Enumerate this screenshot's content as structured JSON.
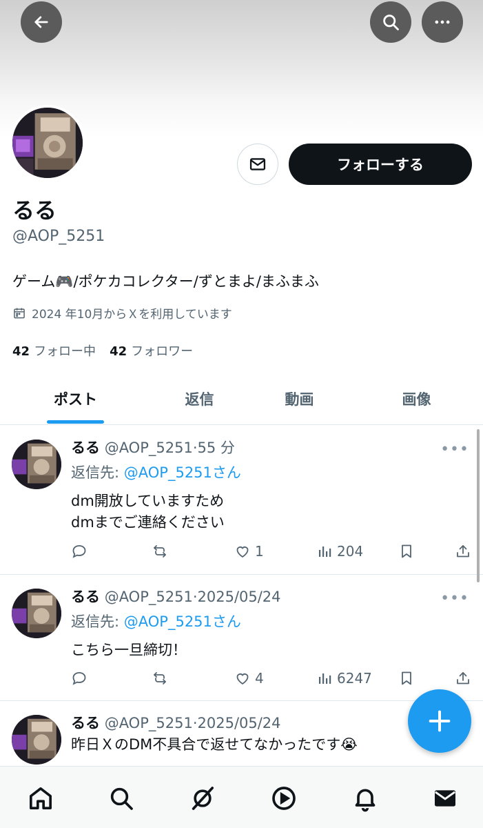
{
  "profile": {
    "display_name": "るる",
    "handle": "@AOP_5251",
    "bio": "ゲーム🎮/ポケカコレクター/ずとまよ/まふまふ",
    "joined": "2024 年10月からＸを利用しています",
    "following_count": "42",
    "following_label": "フォロー中",
    "followers_count": "42",
    "followers_label": "フォロワー",
    "follow_button": "フォローする"
  },
  "tabs": [
    {
      "label": "ポスト",
      "active": true
    },
    {
      "label": "返信",
      "active": false
    },
    {
      "label": "動画",
      "active": false
    },
    {
      "label": "画像",
      "active": false
    }
  ],
  "posts": [
    {
      "name": "るる",
      "meta": "@AOP_5251·55 分",
      "reply_prefix": "返信先: ",
      "reply_target": "@AOP_5251さん",
      "text_lines": [
        "dm開放していますため",
        "dmまでご連絡ください"
      ],
      "likes": "1",
      "views": "204"
    },
    {
      "name": "るる",
      "meta": "@AOP_5251·2025/05/24",
      "reply_prefix": "返信先: ",
      "reply_target": "@AOP_5251さん",
      "text_lines": [
        "こちら一旦締切！"
      ],
      "likes": "4",
      "views": "6247"
    },
    {
      "name": "るる",
      "meta": "@AOP_5251·2025/05/24",
      "text_lines": [
        "昨日ＸのDM不具合で返せてなかったです😭"
      ]
    }
  ],
  "icons": {
    "back": "arrow-left-icon",
    "search": "search-icon",
    "more": "more-horizontal-icon",
    "mail": "mail-icon",
    "calendar": "calendar-icon",
    "reply": "reply-icon",
    "repost": "repost-icon",
    "like": "heart-icon",
    "views": "bar-chart-icon",
    "bookmark": "bookmark-icon",
    "share": "share-icon",
    "compose": "plus-icon",
    "nav": [
      "home-icon",
      "search-icon",
      "grok-icon",
      "video-icon",
      "bell-icon",
      "mail-icon"
    ]
  },
  "colors": {
    "accent": "#1d9bf0",
    "text_primary": "#0f1419",
    "text_secondary": "#536471",
    "follow_button_bg": "#0f1419"
  }
}
